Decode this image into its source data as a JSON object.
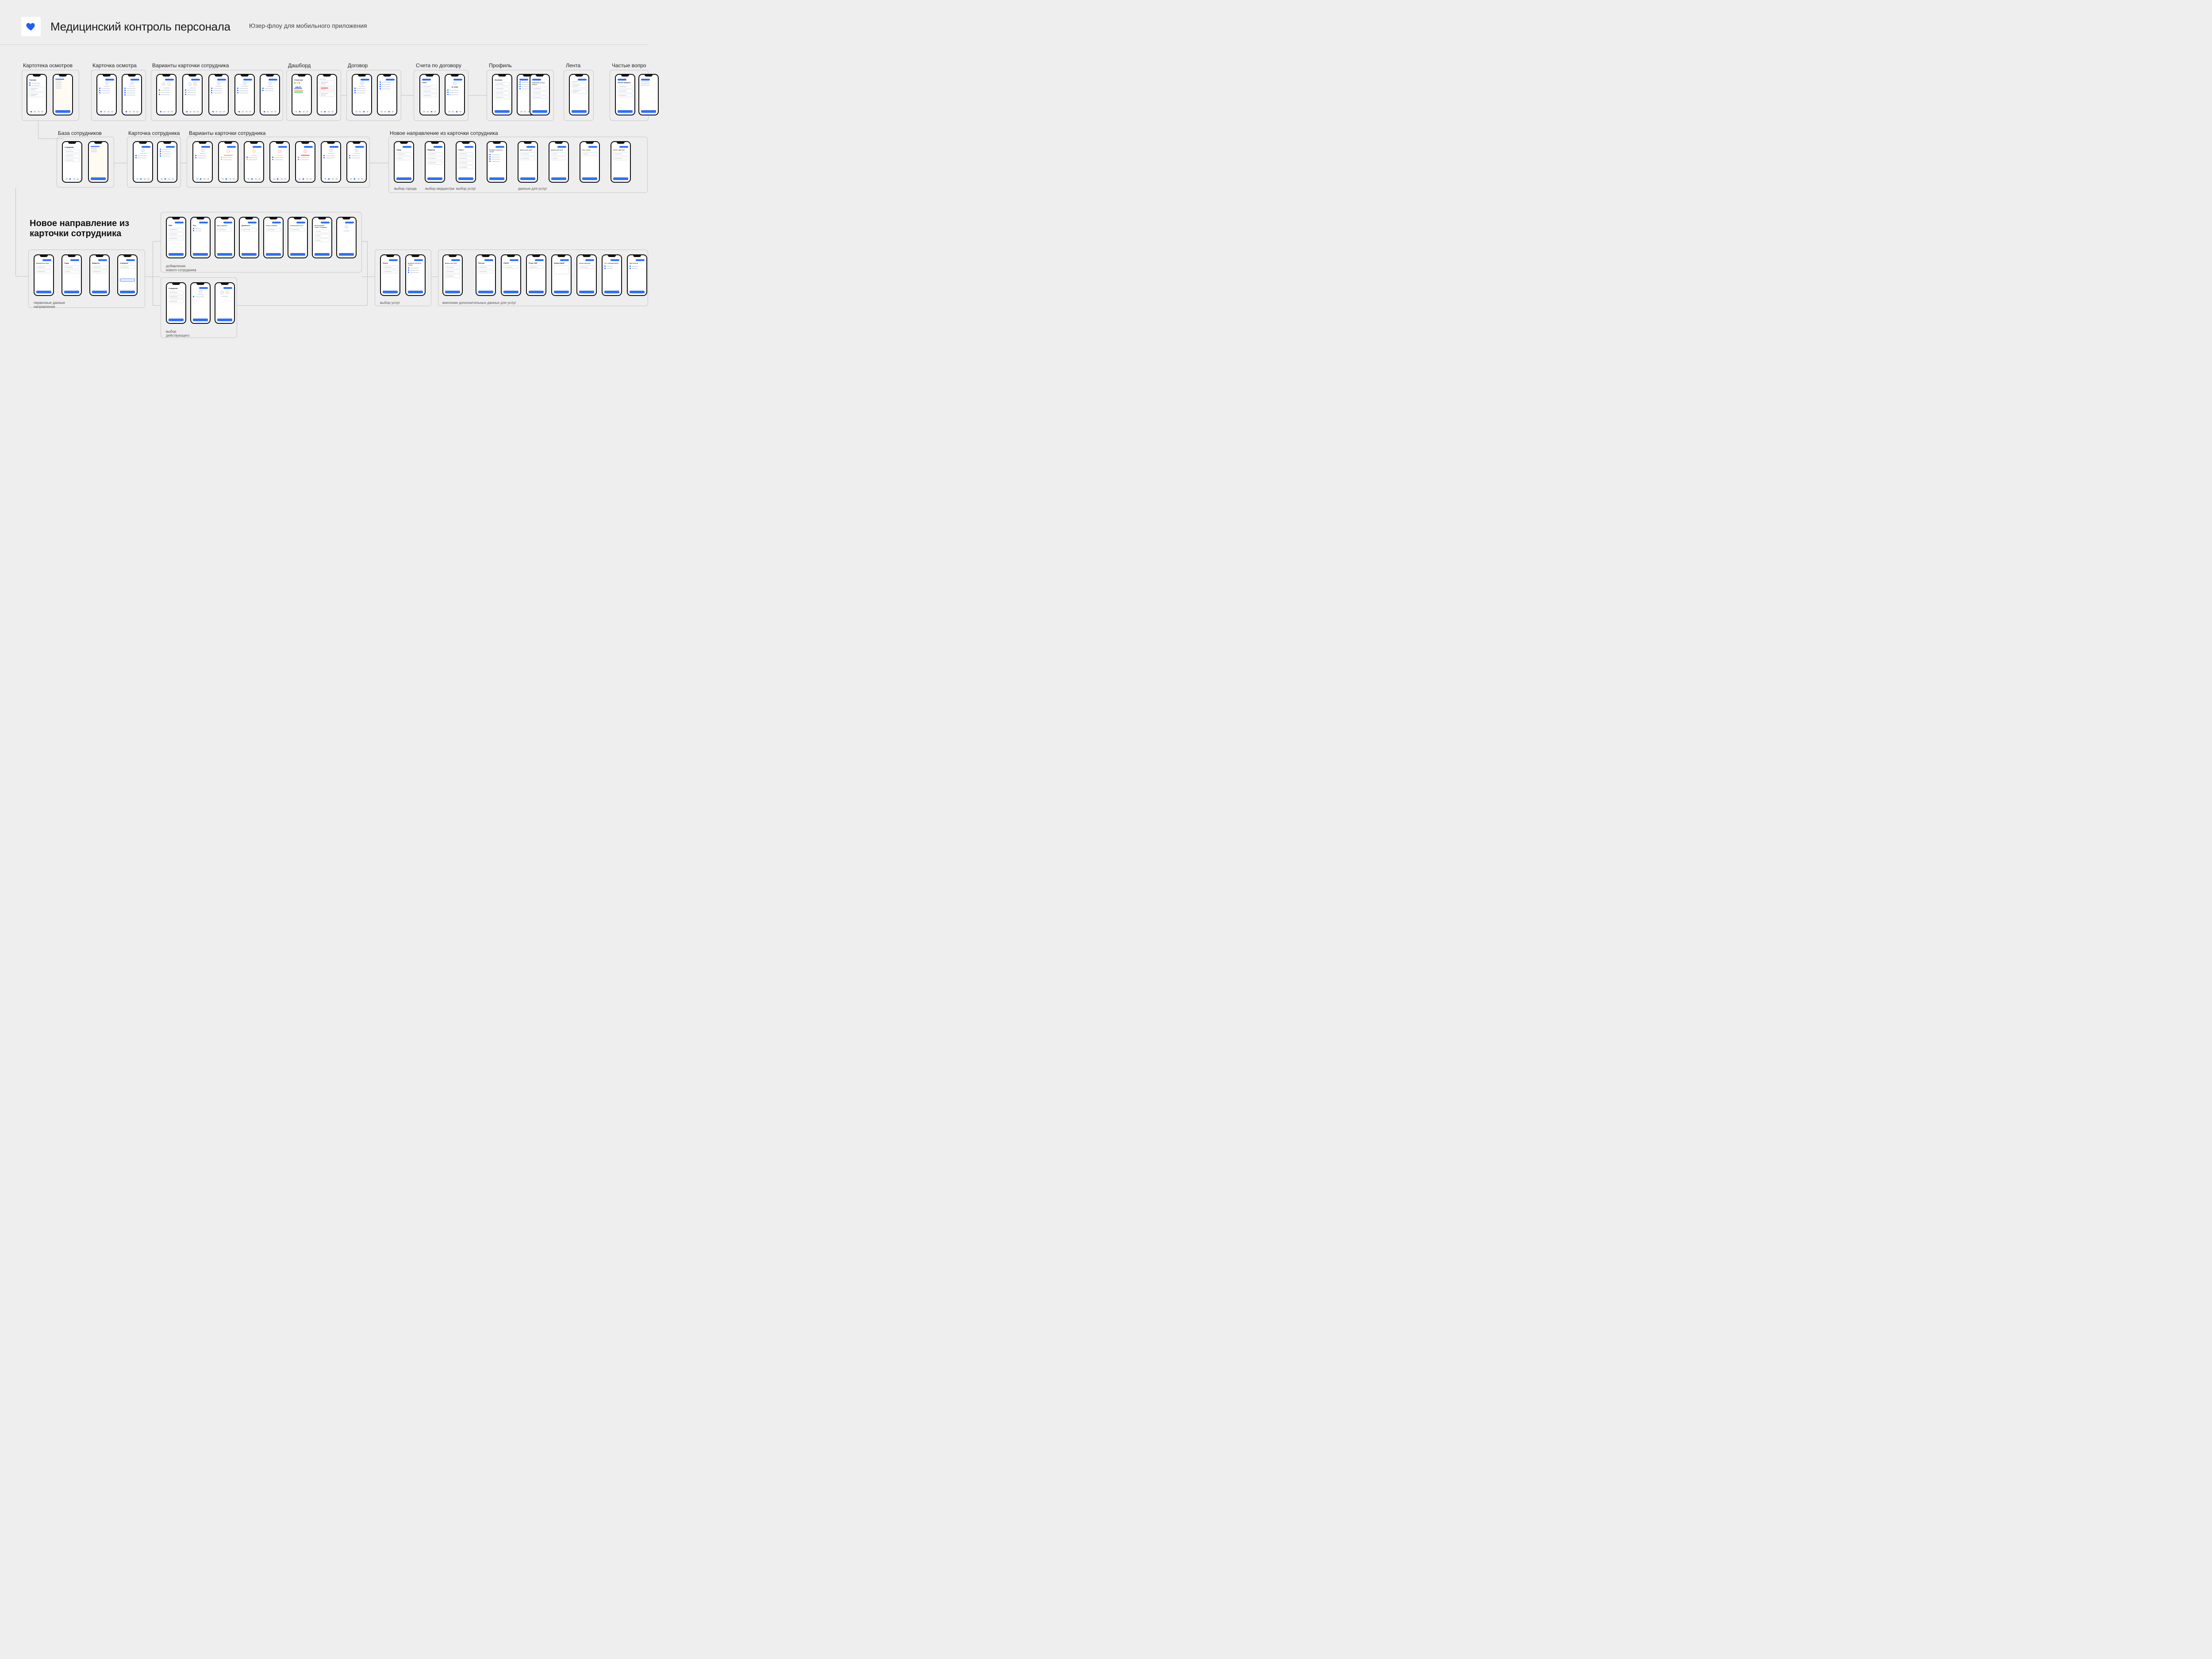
{
  "header": {
    "title": "Медицинский контроль персонала",
    "subtitle": "Юзер-флоу для мобильного приложения"
  },
  "sections": {
    "inspections": "Картотека осмотров",
    "inspection_card": "Карточка осмотра",
    "employee_card_variants_a": "Варианты карточки сотрудника",
    "dashboard": "Дашборд",
    "contract": "Договор",
    "invoices": "Счета по договору",
    "profile": "Профиль",
    "feed": "Лента",
    "faq": "Частые вопро",
    "employee_base": "База сотрудников",
    "employee_card": "Карточка сотрудника",
    "employee_card_variants_b": "Варианты карточки сотрудника",
    "new_referral": "Новое направление из карточки сотрудника",
    "new_referral_big": "Новое направление из\nкарточки сотрудника"
  },
  "captions": {
    "city": "выбор города",
    "medcenter": "выбор медцентра",
    "services": "выбор услуг",
    "service_data": "данные для услуг",
    "primary": "первичные данные\nнаправления",
    "new_employee": "добавление\nнового сотрудника",
    "existing": "выбор\nдействующего",
    "services2": "выбор услуг",
    "extra": "внесение дополнительных данных для услуг"
  },
  "screens": {
    "inspections": "Осмотры",
    "employees": "Сотрудники",
    "statistics": "Статистика",
    "invoices": "Счета",
    "contract_num": "№ 12345",
    "company": "Компания",
    "settings": "Изменение личных данных",
    "faq": "Частые вопросы",
    "entity": "Юридическое лицо",
    "city": "Город",
    "medcenter": "Медцентр",
    "employee": "Сотрудник",
    "services": "Услуги",
    "choose_services": "Выберите услуги из списка",
    "service_data": "Данные для услуг",
    "action_start": "Начало действия",
    "action_end": "Окон. услуги",
    "fio": "ФИО",
    "sex": "Пол",
    "dob": "Дата рождения",
    "position": "Должность",
    "phone": "Номер телефона",
    "email": "Электронная почта",
    "add_new": "Вы добавляете нового сотрудника",
    "passport": "Паспорт",
    "snils": "СНИЛС",
    "oms": "Полис ОМС",
    "comment": "Комментарий",
    "action_begin": "Начало действия",
    "coupon": "Что с направлением?",
    "doctor": "Вид осмотра",
    "ivanov": "Иванов Константин Константинович"
  }
}
